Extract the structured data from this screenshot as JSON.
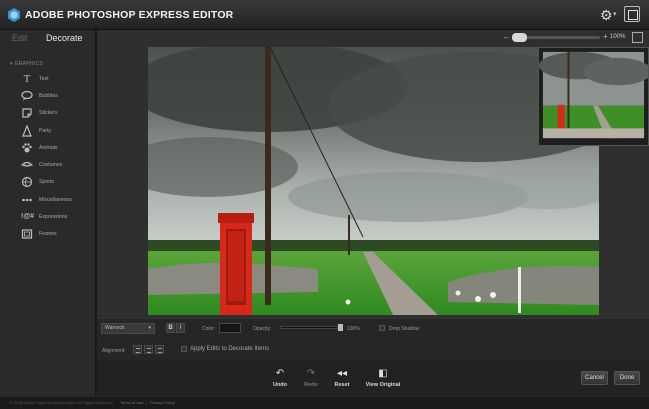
{
  "app": {
    "title": "ADOBE PHOTOSHOP EXPRESS EDITOR"
  },
  "tabs": [
    {
      "label": "Edit"
    },
    {
      "label": "Decorate"
    }
  ],
  "sidebar": {
    "section": "GRAPHICS",
    "items": [
      {
        "label": "Text",
        "icon": "text-icon"
      },
      {
        "label": "Bubbles",
        "icon": "bubble-icon"
      },
      {
        "label": "Stickers",
        "icon": "sticker-icon"
      },
      {
        "label": "Party",
        "icon": "party-icon"
      },
      {
        "label": "Animals",
        "icon": "paw-icon"
      },
      {
        "label": "Costumes",
        "icon": "costume-icon"
      },
      {
        "label": "Sports",
        "icon": "ball-icon"
      },
      {
        "label": "Miscellaneous",
        "icon": "misc-icon"
      },
      {
        "label": "Expressions",
        "icon": "expression-icon"
      },
      {
        "label": "Frames",
        "icon": "frame-icon"
      }
    ]
  },
  "zoom": {
    "minus": "–",
    "plus": "+",
    "value": "100%"
  },
  "properties": {
    "font": "Warnock",
    "bold": "B",
    "italic": "I",
    "color_label": "Color:",
    "opacity_label": "Opacity:",
    "opacity_value": "100%",
    "drop_shadow_label": "Drop Shadow",
    "alignment_label": "Alignment:",
    "apply_label": "Apply Edits to Decorate Items"
  },
  "actions": {
    "undo": "Undo",
    "redo": "Redo",
    "reset": "Reset",
    "view_original": "View Original",
    "cancel": "Cancel",
    "done": "Done"
  },
  "footer": {
    "copyright": "© 2008 Adobe Systems Incorporated. All Rights Reserved.",
    "terms": "Terms of Use",
    "separator": "|",
    "privacy": "Privacy Policy"
  },
  "colors": {
    "accent": "#4ea0e0",
    "phone_box": "#e02818",
    "grass": "#3d9a28"
  }
}
